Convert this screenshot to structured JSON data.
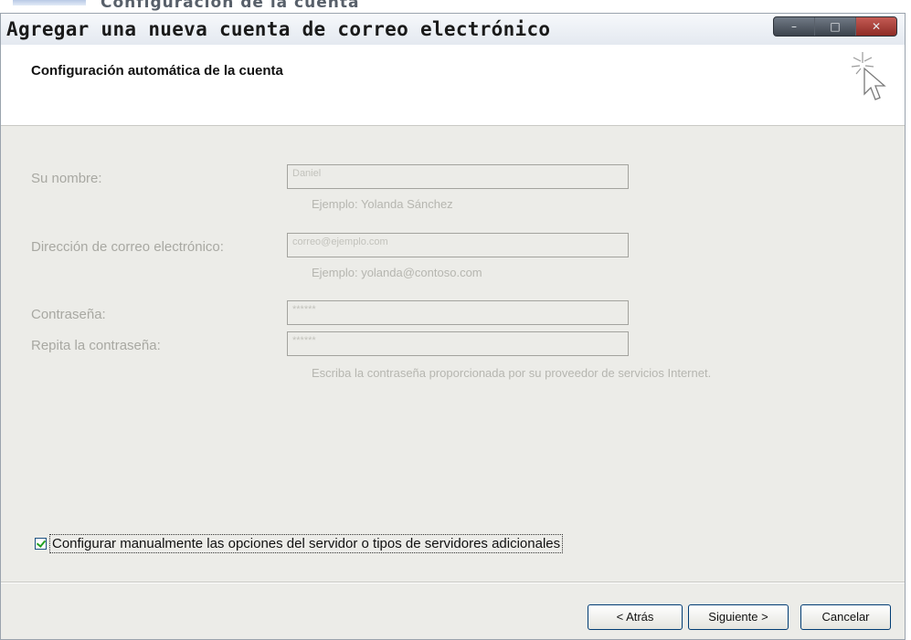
{
  "background_window": {
    "title": "Configuración de la cuenta"
  },
  "dialog": {
    "title": "Agregar una nueva cuenta de correo electrónico",
    "header_title": "Configuración automática de la cuenta"
  },
  "form": {
    "name_label": "Su nombre:",
    "name_value": "Daniel",
    "name_hint": "Ejemplo: Yolanda Sánchez",
    "email_label": "Dirección de correo electrónico:",
    "email_value": "correo@ejemplo.com",
    "email_hint": "Ejemplo: yolanda@contoso.com",
    "password_label": "Contraseña:",
    "password_value": "******",
    "repeat_password_label": "Repita la contraseña:",
    "repeat_password_value": "******",
    "password_hint": "Escriba la contraseña proporcionada por su proveedor de servicios Internet."
  },
  "manual_config": {
    "label": "Configurar manualmente las opciones del servidor o tipos de servidores adicionales",
    "checked": true
  },
  "buttons": {
    "back": "< Atrás",
    "next": "Siguiente >",
    "cancel": "Cancelar"
  }
}
